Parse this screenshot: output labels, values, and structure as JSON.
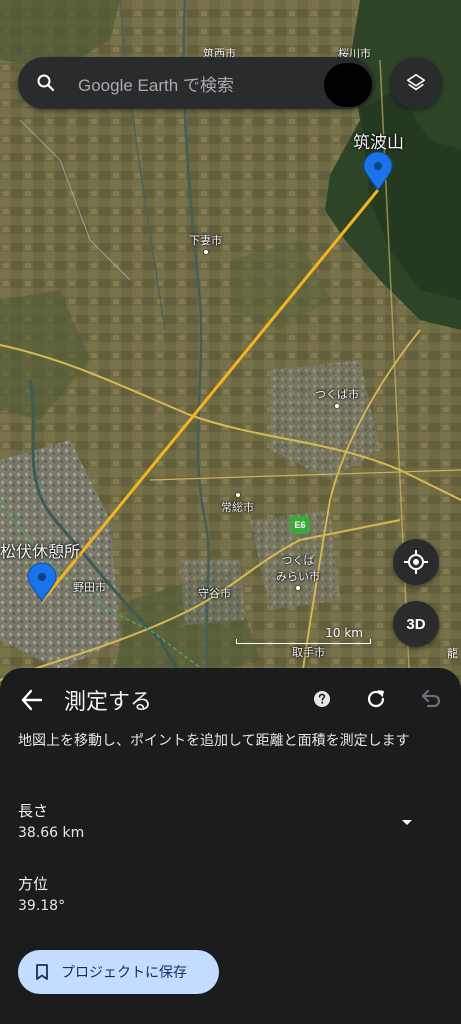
{
  "search": {
    "placeholder": "Google Earth で検索"
  },
  "map": {
    "places": {
      "chikusei_cut": "筑西市",
      "sakuragawa_cut": "桜川市",
      "tsukubasan": "筑波山",
      "shimotsuma": "下妻市",
      "tsukuba": "つくば市",
      "joso": "常総市",
      "tsukubamirai_1": "つくば",
      "tsukubamirai_2": "みらい市",
      "moriya": "守谷市",
      "noda": "野田市",
      "toride": "取手市",
      "matsubushi": "松伏休憩所",
      "ryu_cut": "龍"
    },
    "highway_badge": "E6",
    "scale_label": "10 km",
    "button_3d": "3D",
    "measure_line_color": "#f2b51e",
    "pin_color": "#1a73e8"
  },
  "measure_panel": {
    "title": "測定する",
    "instructions": "地図上を移動し、ポイントを追加して距離と面積を測定します",
    "length_label": "長さ",
    "length_value": "38.66 km",
    "bearing_label": "方位",
    "bearing_value": "39.18°",
    "save_button": "プロジェクトに保存"
  }
}
